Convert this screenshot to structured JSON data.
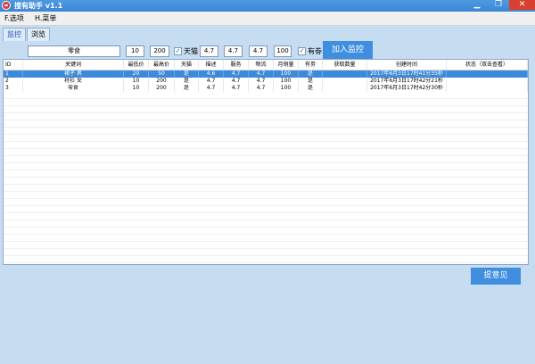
{
  "window": {
    "title": "搜有助手 v1.1",
    "min_glyph": "▁",
    "max_glyph": "❐",
    "close_glyph": "✕"
  },
  "menu": {
    "items": [
      "F.选项",
      "H.菜单"
    ]
  },
  "tabs": [
    {
      "label": "监控",
      "active": true
    },
    {
      "label": "浏览",
      "active": false
    }
  ],
  "form": {
    "keyword": "零食",
    "min_price": "10",
    "max_price": "200",
    "tmall_checked": true,
    "tmall_label": "天猫",
    "describe": "4.7",
    "service": "4.7",
    "logistics": "4.7",
    "monthly_sales": "100",
    "coupon_checked": true,
    "coupon_label": "有劵",
    "check_mark": "✓",
    "add_button": "加入监控"
  },
  "table": {
    "columns": [
      "ID",
      "关键词",
      "最低价",
      "最高价",
      "天猫",
      "描述",
      "服务",
      "物流",
      "月销量",
      "有劵",
      "获取数量",
      "创建时间",
      "状态（双击查看）"
    ],
    "rows": [
      {
        "cells": [
          "1",
          "裙子 男",
          "20",
          "50",
          "是",
          "4.6",
          "4.7",
          "4.7",
          "100",
          "是",
          "",
          "2017年6月3日17时41分35秒",
          ""
        ],
        "selected": true
      },
      {
        "cells": [
          "2",
          "衬衫 女",
          "10",
          "200",
          "是",
          "4.7",
          "4.7",
          "4.7",
          "100",
          "是",
          "",
          "2017年6月3日17时42分21秒",
          ""
        ],
        "selected": false
      },
      {
        "cells": [
          "3",
          "零食",
          "10",
          "200",
          "是",
          "4.7",
          "4.7",
          "4.7",
          "100",
          "是",
          "",
          "2017年6月3日17时42分30秒",
          ""
        ],
        "selected": false
      }
    ]
  },
  "feedback_button": "提意见",
  "colors": {
    "titlebar": "#3b86d6",
    "accent_button": "#3f8ee0",
    "selected_row": "#3d8ad9",
    "background": "#c6dcf1",
    "close_button": "#d9402f"
  }
}
